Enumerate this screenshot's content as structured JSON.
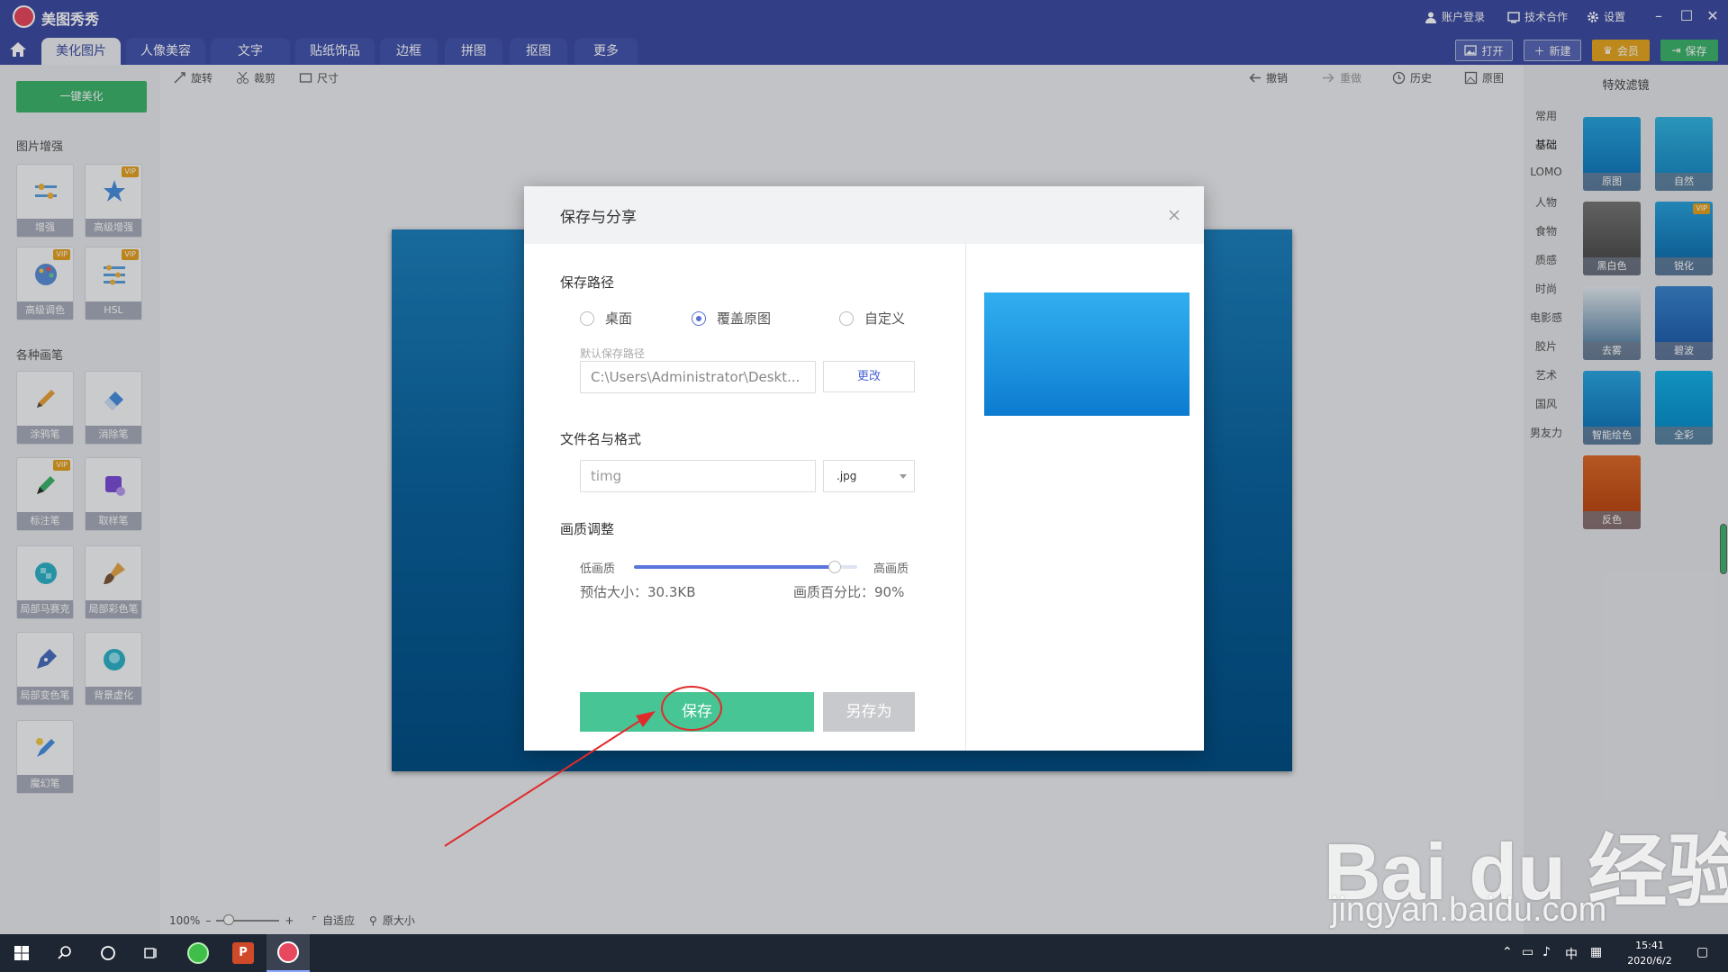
{
  "app": {
    "title": "美图秀秀",
    "account": "账户登录",
    "cooperation": "技术合作",
    "settings": "设置"
  },
  "tabs": [
    "美化图片",
    "人像美容",
    "文字",
    "贴纸饰品",
    "边框",
    "拼图",
    "抠图",
    "更多"
  ],
  "top_buttons": {
    "open": "打开",
    "new": "新建",
    "vip": "会员",
    "save": "保存"
  },
  "left": {
    "one_key": "一键美化",
    "section1": "图片增强",
    "tools1": [
      "增强",
      "高级增强",
      "高级调色",
      "HSL"
    ],
    "section2": "各种画笔",
    "tools2": [
      "涂鸦笔",
      "消除笔",
      "标注笔",
      "取样笔",
      "局部马赛克",
      "局部彩色笔",
      "局部变色笔",
      "背景虚化",
      "魔幻笔"
    ],
    "vip_tag": "VIP"
  },
  "edit_tools": {
    "rotate": "旋转",
    "crop": "裁剪",
    "size": "尺寸",
    "undo": "撤销",
    "redo": "重做",
    "history": "历史",
    "original": "原图"
  },
  "right": {
    "title": "特效滤镜",
    "categories": [
      "常用",
      "基础",
      "LOMO",
      "人物",
      "食物",
      "质感",
      "时尚",
      "电影感",
      "胶片",
      "艺术",
      "国风",
      "男友力"
    ],
    "filters": [
      "原图",
      "自然",
      "黑白色",
      "锐化",
      "去雾",
      "智能绘色",
      "全彩",
      "反色"
    ],
    "filter_5": "碧波"
  },
  "bottom": {
    "zoom": "100%",
    "fit": "自适应",
    "original_size": "原大小"
  },
  "dialog": {
    "title": "保存与分享",
    "save_path_label": "保存路径",
    "options": [
      "桌面",
      "覆盖原图",
      "自定义"
    ],
    "selected_option": "覆盖原图",
    "default_path_label": "默认保存路径",
    "path_value": "C:\\Users\\Administrator\\Deskt...",
    "change": "更改",
    "file_label": "文件名与格式",
    "filename": "timg",
    "format": ".jpg",
    "quality_label": "画质调整",
    "low": "低画质",
    "high": "高画质",
    "quality_value": 0.9,
    "est_size": "预估大小：30.3KB",
    "quality_pct": "画质百分比：90%",
    "save": "保存",
    "save_as": "另存为"
  },
  "watermark": {
    "logo": "Bai du 经验",
    "url": "jingyan.baidu.com"
  },
  "taskbar": {
    "time": "15:41",
    "date": "2020/6/2",
    "ime": "中"
  },
  "colors": {
    "brand": "#3d4da4",
    "save_green": "#47c595",
    "annotation_red": "#e02b2b"
  }
}
